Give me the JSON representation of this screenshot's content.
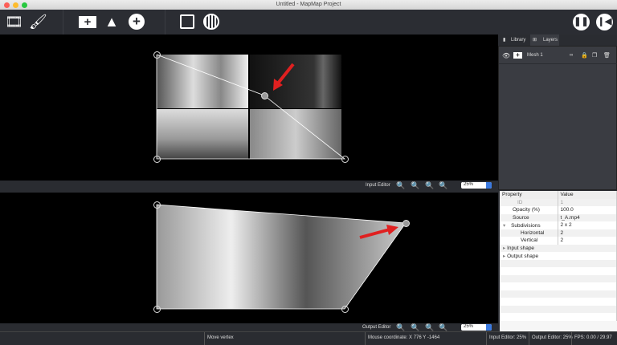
{
  "window": {
    "title": "Untitled - MapMap Project",
    "colors": {
      "close": "#fc5f57",
      "min": "#fdbc2e",
      "max": "#28c840"
    }
  },
  "toolbar": {
    "icons": [
      "add-media-icon",
      "add-paint-icon",
      "add-mesh-icon",
      "add-triangle-icon",
      "add-ellipse-icon",
      "fullscreen-icon",
      "test-signal-icon",
      "pause-icon",
      "rewind-icon"
    ]
  },
  "input_editor": {
    "label": "Input Editor",
    "zoom": "25%"
  },
  "output_editor": {
    "label": "Output Editor",
    "zoom": "25%"
  },
  "panel": {
    "tabs": [
      {
        "label": "Library"
      },
      {
        "label": "Layers"
      }
    ],
    "layers": [
      {
        "name": "Mesh 1",
        "visible": true
      }
    ],
    "properties": {
      "header": [
        "Property",
        "Value"
      ],
      "rows": [
        [
          "ID",
          "1"
        ],
        [
          "Opacity (%)",
          "100.0"
        ],
        [
          "Source",
          "t_A.mp4"
        ],
        [
          "Subdivisions",
          "2 x 2"
        ],
        [
          "Horizontal",
          "2"
        ],
        [
          "Vertical",
          "2"
        ],
        [
          "Input shape",
          ""
        ],
        [
          "Output shape",
          ""
        ]
      ]
    }
  },
  "status": {
    "action": "Move vertex",
    "mouse": "Mouse coordinate:  X 776  Y -1464",
    "input_zoom": "Input Editor: 25%",
    "output_zoom": "Output Editor: 25%",
    "fps": "FPS: 0.00 / 29.97"
  },
  "accent": "#e02020"
}
